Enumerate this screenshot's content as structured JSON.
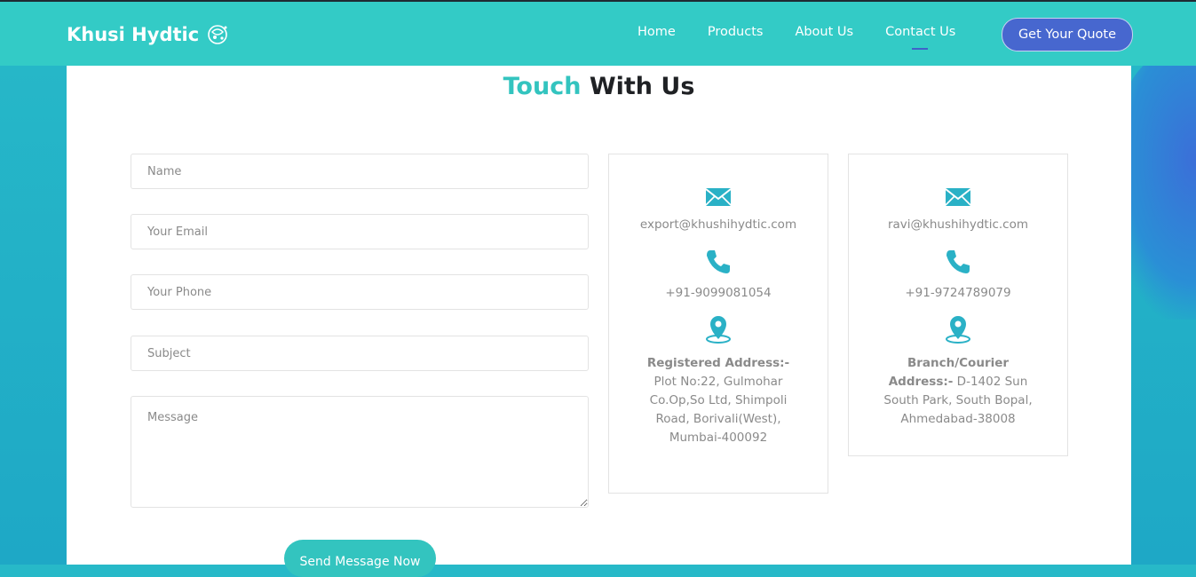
{
  "header": {
    "brand": "Khusi Hydtic",
    "nav": [
      "Home",
      "Products",
      "About Us",
      "Contact Us"
    ],
    "active_nav": "Contact Us",
    "quote_button": "Get Your Quote"
  },
  "heading": {
    "accent": "Touch",
    "rest": "With Us"
  },
  "form": {
    "name_placeholder": "Name",
    "email_placeholder": "Your Email",
    "phone_placeholder": "Your Phone",
    "subject_placeholder": "Subject",
    "message_placeholder": "Message",
    "submit_label": "Send Message Now"
  },
  "cards": [
    {
      "email": "export@khushihydtic.com",
      "phone": "+91-9099081054",
      "address_label": "Registered Address:-",
      "address": "Plot No:22, Gulmohar Co.Op,So Ltd, Shimpoli Road, Borivali(West), Mumbai-400092"
    },
    {
      "email": "ravi@khushihydtic.com",
      "phone": "+91-9724789079",
      "address_label": "Branch/Courier Address:-",
      "address": "D-1402 Sun South Park, South Bopal, Ahmedabad-38008"
    }
  ],
  "icons": [
    "envelope-icon",
    "phone-icon",
    "map-pin-icon",
    "logo-icon"
  ],
  "colors": {
    "header": "#33cbc6",
    "accent": "#33c4bf",
    "button": "#4767cf",
    "text": "#8a8a8a"
  }
}
